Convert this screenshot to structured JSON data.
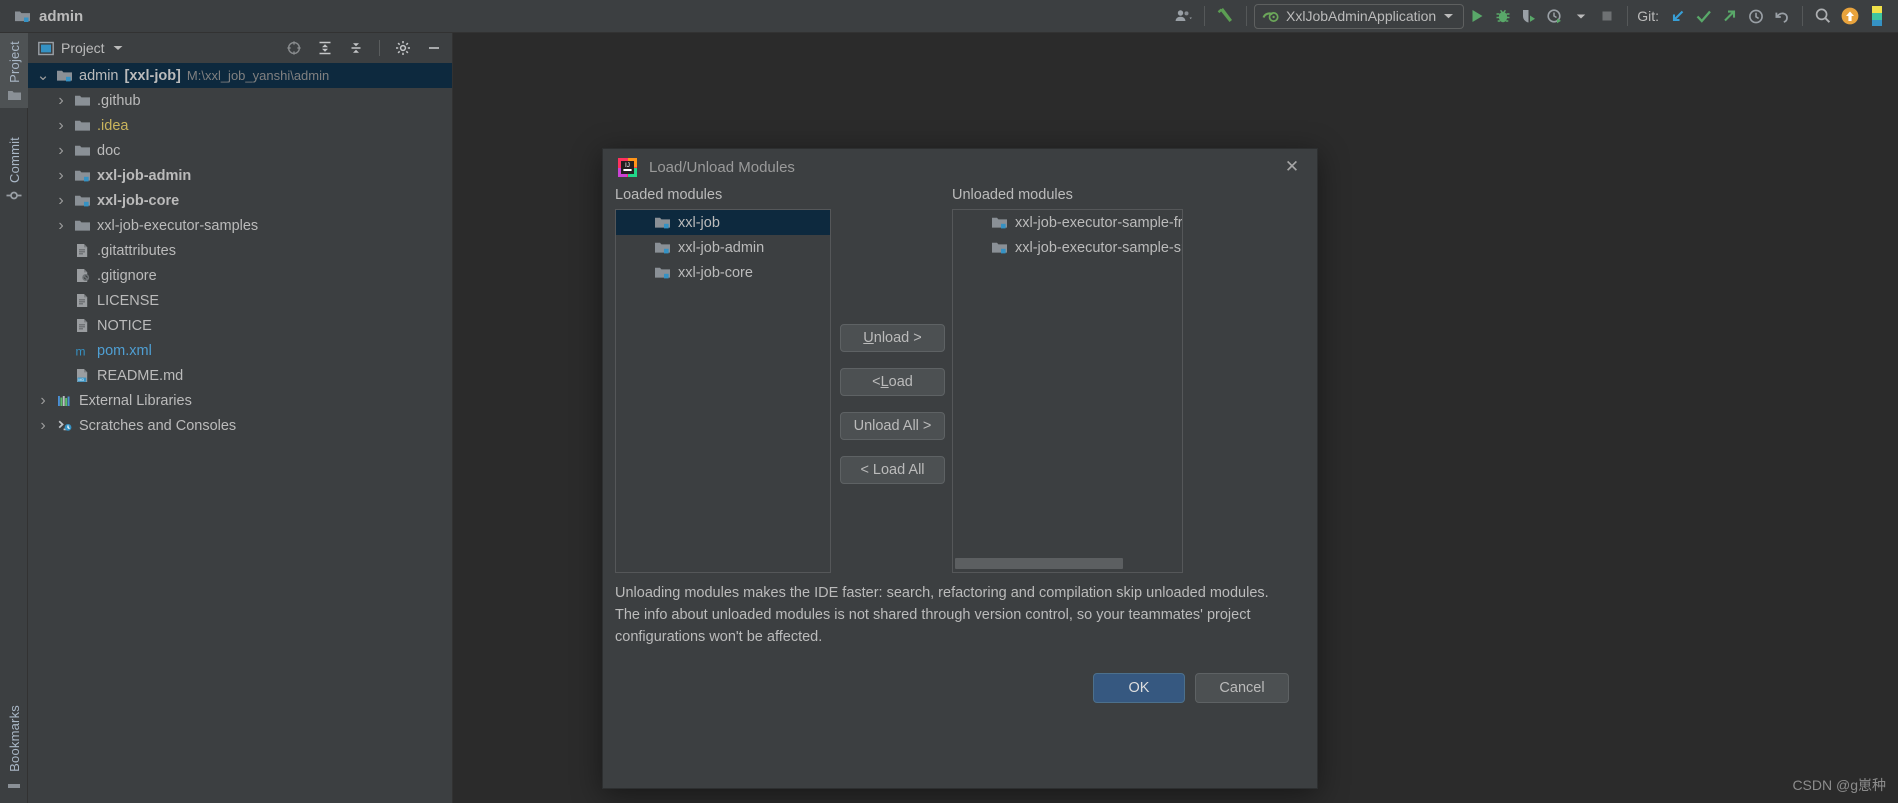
{
  "app": {
    "project_name": "admin",
    "watermark": "CSDN @g崽种"
  },
  "toolbar": {
    "run_config_name": "XxlJobAdminApplication",
    "git_label": "Git:",
    "icons": {
      "account": "account-icon",
      "chevron": "chevron-down-icon",
      "build": "build-hammer-icon",
      "run": "run-icon",
      "debug": "debug-icon",
      "coverage": "run-coverage-icon",
      "profile": "run-profiler-icon",
      "stop": "stop-icon",
      "update": "git-update-icon",
      "commit": "git-commit-icon",
      "push": "git-push-icon",
      "history": "history-icon",
      "rollback": "rollback-icon",
      "search": "search-everywhere-icon",
      "notifications": "notifications-icon"
    }
  },
  "tool_strip": {
    "tabs": [
      {
        "label": "Project",
        "icon": "folder-icon",
        "active": true
      },
      {
        "label": "Commit",
        "icon": "commit-icon",
        "active": false
      },
      {
        "label": "Bookmarks",
        "icon": "bookmark-icon",
        "active": false
      }
    ]
  },
  "project_panel": {
    "title": "Project",
    "header_icons": [
      "scroll-from-source-icon",
      "expand-all-icon",
      "collapse-all-icon",
      "settings-gear-icon",
      "hide-icon"
    ],
    "tree": [
      {
        "label": "admin",
        "suffix": "[xxl-job]",
        "path": "M:\\xxl_job_yanshi\\admin",
        "indent": 0,
        "arrow": "expanded",
        "icon": "module-folder-icon",
        "selected": true,
        "style": "plain"
      },
      {
        "label": ".github",
        "indent": 1,
        "arrow": "collapsed",
        "icon": "folder-icon",
        "style": "plain"
      },
      {
        "label": ".idea",
        "indent": 1,
        "arrow": "collapsed",
        "icon": "folder-icon",
        "style": "yellow"
      },
      {
        "label": "doc",
        "indent": 1,
        "arrow": "collapsed",
        "icon": "folder-icon",
        "style": "plain"
      },
      {
        "label": "xxl-job-admin",
        "indent": 1,
        "arrow": "collapsed",
        "icon": "module-folder-icon",
        "style": "bold"
      },
      {
        "label": "xxl-job-core",
        "indent": 1,
        "arrow": "collapsed",
        "icon": "module-folder-icon",
        "style": "bold"
      },
      {
        "label": "xxl-job-executor-samples",
        "indent": 1,
        "arrow": "collapsed",
        "icon": "folder-icon",
        "style": "plain"
      },
      {
        "label": ".gitattributes",
        "indent": 1,
        "arrow": "none",
        "icon": "text-file-icon",
        "style": "plain"
      },
      {
        "label": ".gitignore",
        "indent": 1,
        "arrow": "none",
        "icon": "gitignore-file-icon",
        "style": "plain"
      },
      {
        "label": "LICENSE",
        "indent": 1,
        "arrow": "none",
        "icon": "text-file-icon",
        "style": "plain"
      },
      {
        "label": "NOTICE",
        "indent": 1,
        "arrow": "none",
        "icon": "text-file-icon",
        "style": "plain"
      },
      {
        "label": "pom.xml",
        "indent": 1,
        "arrow": "none",
        "icon": "maven-file-icon",
        "style": "blue"
      },
      {
        "label": "README.md",
        "indent": 1,
        "arrow": "none",
        "icon": "markdown-file-icon",
        "style": "plain"
      },
      {
        "label": "External Libraries",
        "indent": 0,
        "arrow": "collapsed",
        "icon": "libraries-icon",
        "style": "plain"
      },
      {
        "label": "Scratches and Consoles",
        "indent": 0,
        "arrow": "collapsed",
        "icon": "scratches-icon",
        "style": "plain"
      }
    ]
  },
  "dialog": {
    "title": "Load/Unload Modules",
    "icon": "intellij-idea-icon",
    "close_label": "✕",
    "loaded_label": "Loaded modules",
    "unloaded_label": "Unloaded modules",
    "loaded_modules": [
      {
        "name": "xxl-job",
        "selected": true
      },
      {
        "name": "xxl-job-admin",
        "selected": false
      },
      {
        "name": "xxl-job-core",
        "selected": false
      }
    ],
    "unloaded_modules": [
      {
        "name": "xxl-job-executor-sample-frameless",
        "selected": false
      },
      {
        "name": "xxl-job-executor-sample-springboot",
        "selected": false
      }
    ],
    "buttons": {
      "unload": {
        "pre": "",
        "mnemonic": "U",
        "post": "nload >"
      },
      "load": {
        "pre": "< ",
        "mnemonic": "L",
        "post": "oad"
      },
      "unload_all": "Unload All >",
      "load_all": "< Load All"
    },
    "description": "Unloading modules makes the IDE faster: search, refactoring and compilation skip unloaded modules. The info about unloaded modules is not shared through version control, so your teammates' project configurations won't be affected.",
    "ok_label": "OK",
    "cancel_label": "Cancel"
  },
  "colors": {
    "panel_bg": "#3c3f41",
    "editor_bg": "#2b2b2b",
    "selection": "#0d293e",
    "accent_blue": "#365880",
    "text": "#bbbbbb",
    "folder_yellow": "#c9b45d",
    "link_blue": "#4f9fd3"
  }
}
